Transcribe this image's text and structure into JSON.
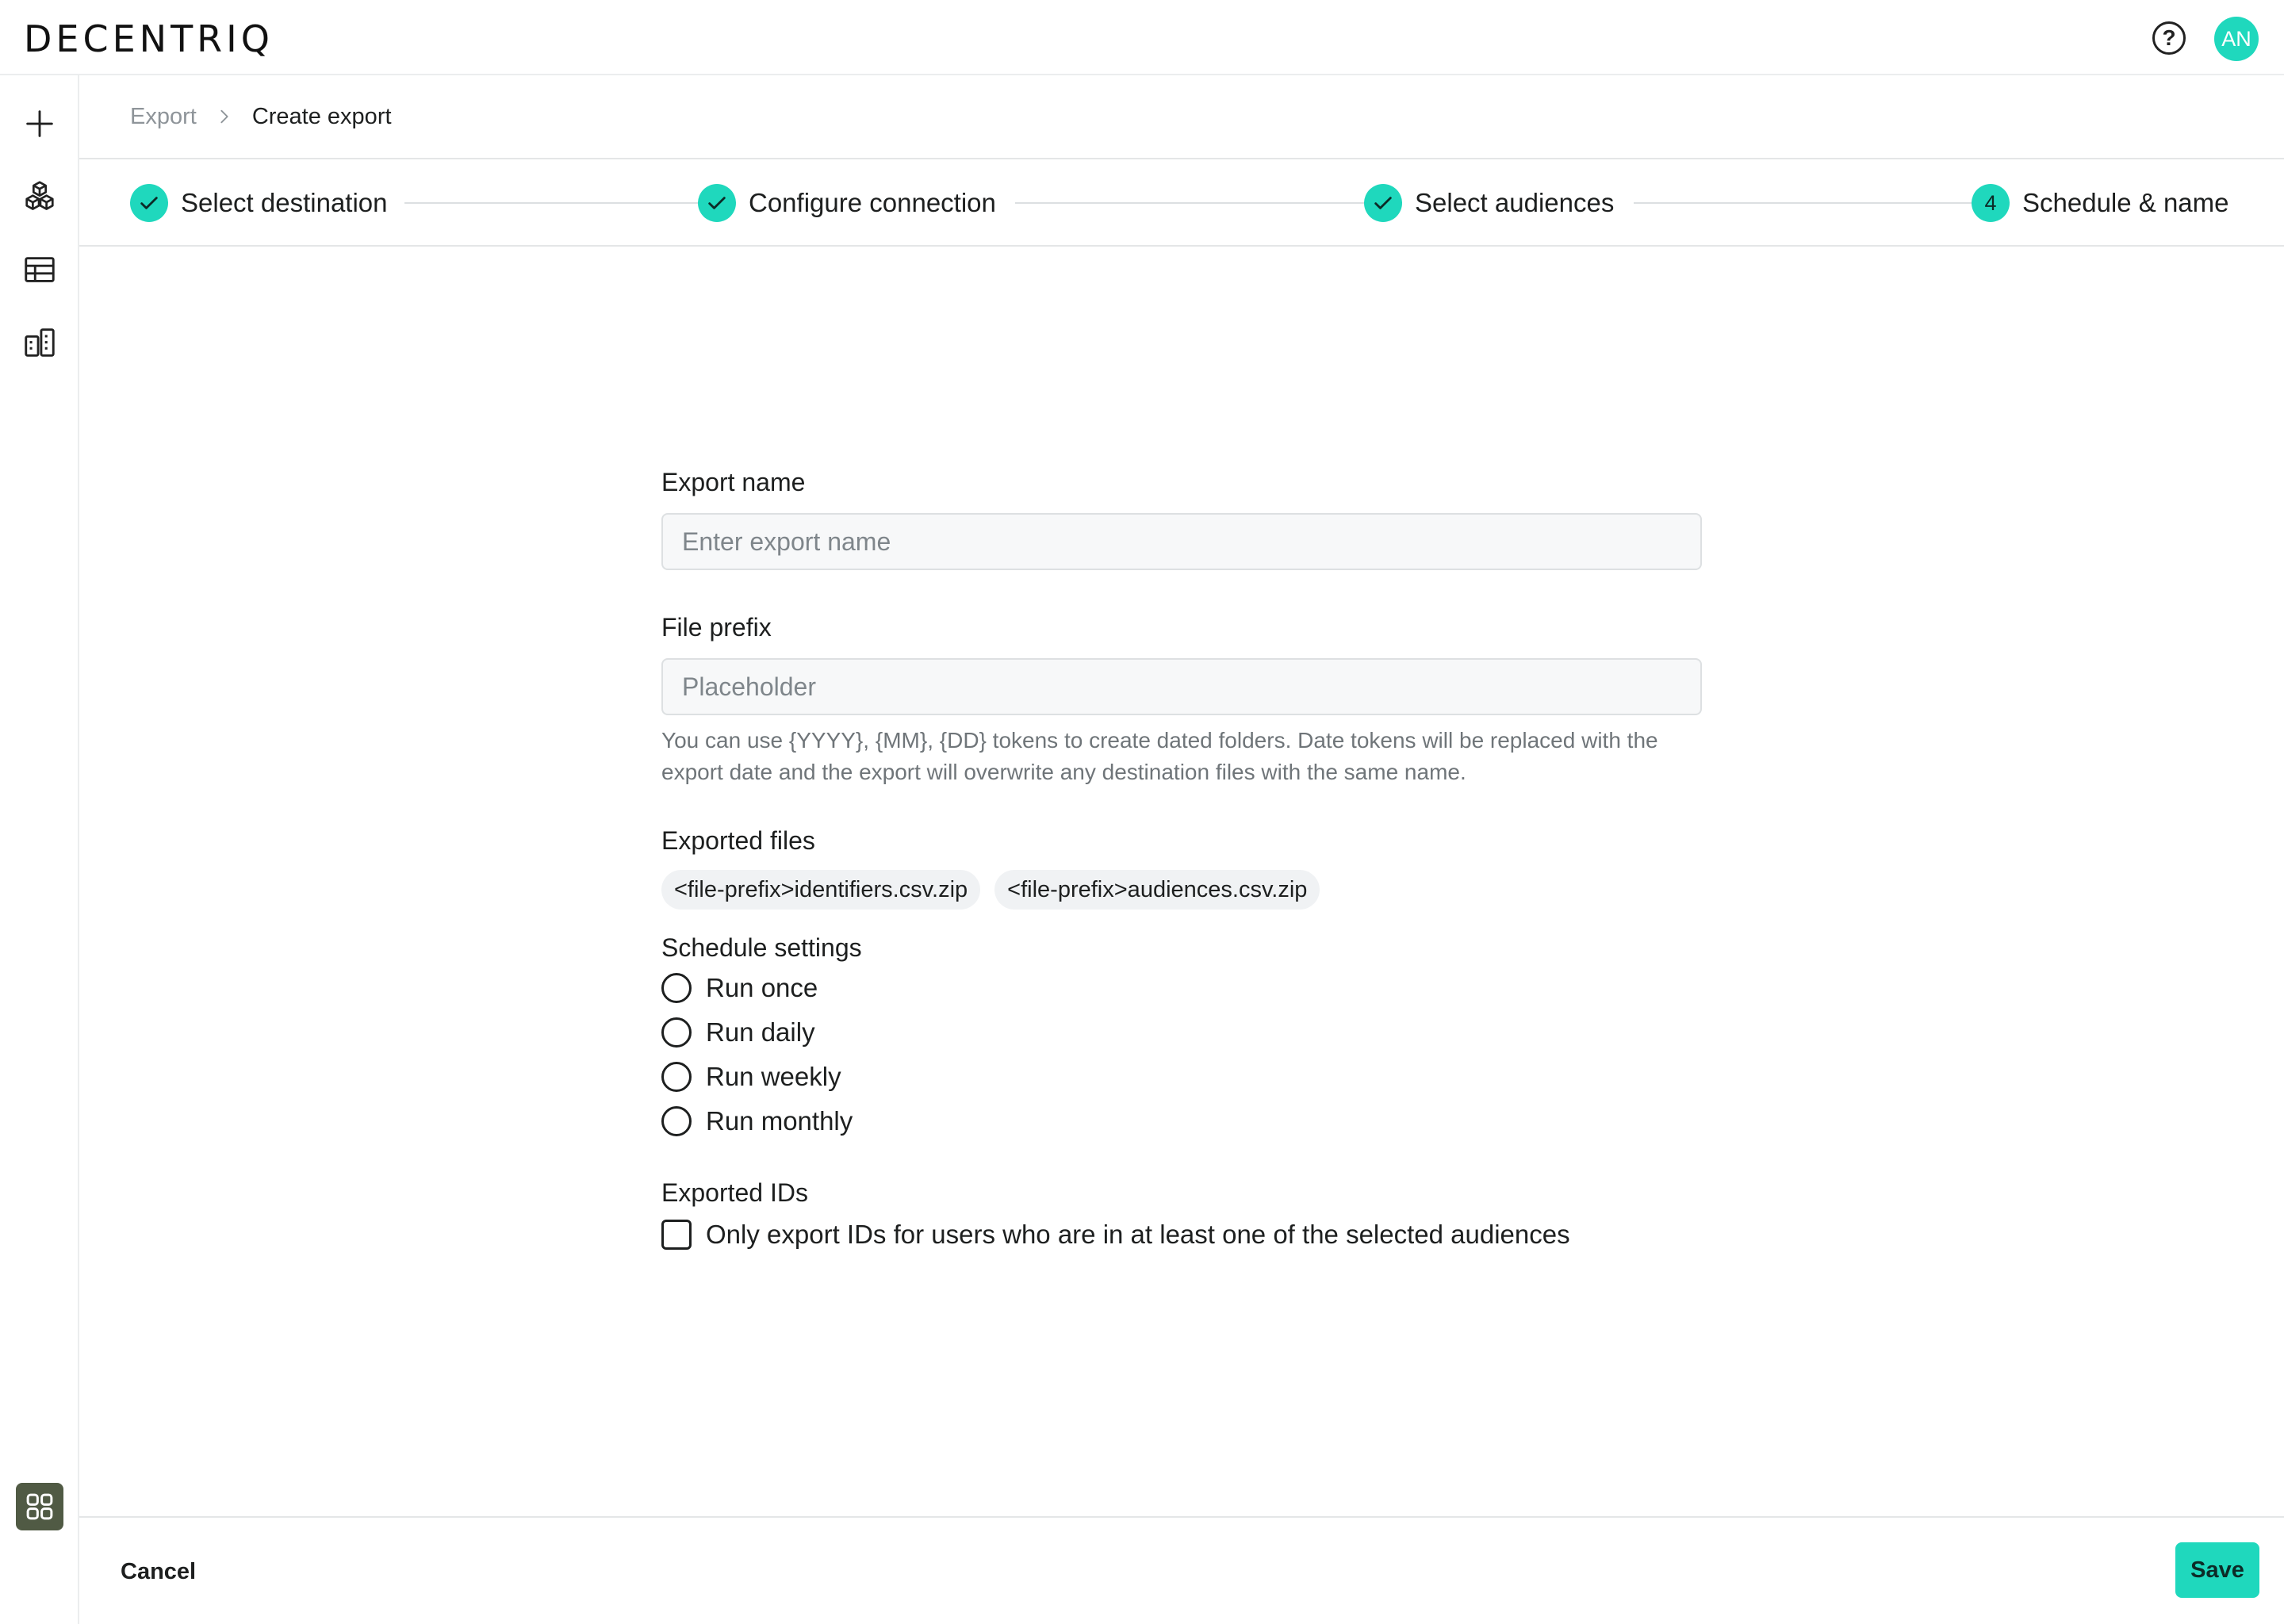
{
  "app": {
    "logo": "DECENTRIQ",
    "avatar_initials": "AN"
  },
  "colors": {
    "accent": "#1fd8bd",
    "app_switcher": "#505a44"
  },
  "icons": {
    "help": "question-circle-icon",
    "sidebar": [
      "plus-icon",
      "cubes-icon",
      "table-icon",
      "buildings-icon"
    ],
    "app_switcher": "apps-grid-icon",
    "expand": "double-chevron-right-icon"
  },
  "breadcrumb": {
    "parent": "Export",
    "current": "Create export"
  },
  "stepper": {
    "steps": [
      {
        "label": "Select destination",
        "state": "complete",
        "number": ""
      },
      {
        "label": "Configure connection",
        "state": "complete",
        "number": ""
      },
      {
        "label": "Select audiences",
        "state": "complete",
        "number": ""
      },
      {
        "label": "Schedule & name",
        "state": "active",
        "number": "4"
      }
    ]
  },
  "form": {
    "export_name": {
      "label": "Export name",
      "placeholder": "Enter export name",
      "value": ""
    },
    "file_prefix": {
      "label": "File prefix",
      "placeholder": "Placeholder",
      "value": "",
      "hint": "You can use {YYYY}, {MM}, {DD} tokens to create dated folders. Date tokens will be replaced with the export date and the export will overwrite any destination files with the same name."
    },
    "exported_files": {
      "label": "Exported files",
      "files": [
        "<file-prefix>identifiers.csv.zip",
        "<file-prefix>audiences.csv.zip"
      ]
    },
    "schedule": {
      "label": "Schedule settings",
      "options": [
        "Run once",
        "Run daily",
        "Run weekly",
        "Run monthly"
      ],
      "selected": ""
    },
    "exported_ids": {
      "label": "Exported IDs",
      "checkbox_label": "Only export IDs for users who are in at least one of the selected audiences",
      "checked": false
    }
  },
  "footer": {
    "cancel_label": "Cancel",
    "save_label": "Save"
  }
}
